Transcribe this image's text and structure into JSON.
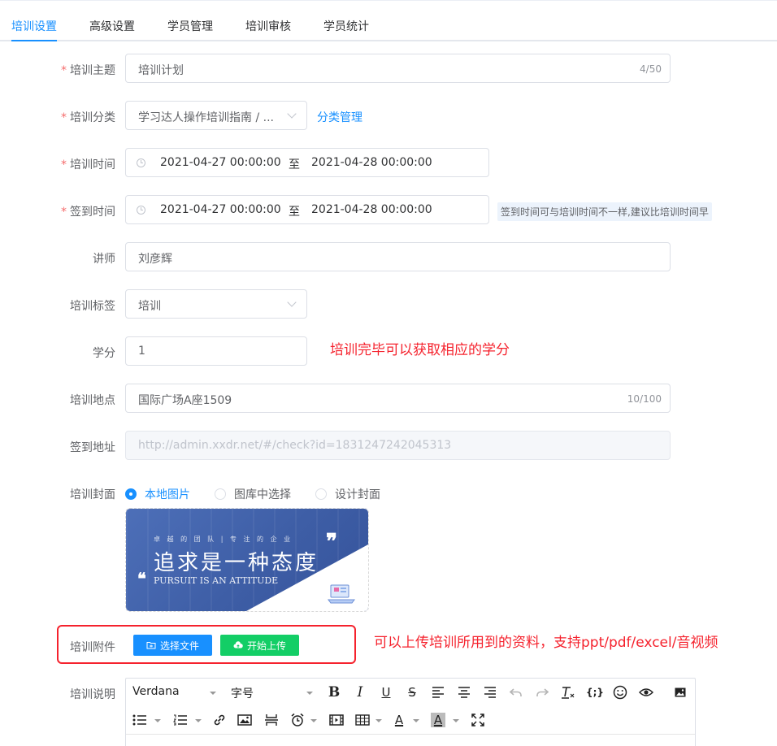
{
  "tabs": [
    {
      "label": "培训设置",
      "active": true
    },
    {
      "label": "高级设置",
      "active": false
    },
    {
      "label": "学员管理",
      "active": false
    },
    {
      "label": "培训审核",
      "active": false
    },
    {
      "label": "学员统计",
      "active": false
    }
  ],
  "form": {
    "topic": {
      "label": "培训主题",
      "value": "培训计划",
      "count": "4/50"
    },
    "category": {
      "label": "培训分类",
      "value": "学习达人操作培训指南 / ...",
      "manage_link": "分类管理"
    },
    "train_time": {
      "label": "培训时间",
      "start": "2021-04-27 00:00:00",
      "sep": "至",
      "end": "2021-04-28 00:00:00"
    },
    "signin_time": {
      "label": "签到时间",
      "start": "2021-04-27 00:00:00",
      "sep": "至",
      "end": "2021-04-28 00:00:00",
      "tip": "签到时间可与培训时间不一样,建议比培训时间早"
    },
    "lecturer": {
      "label": "讲师",
      "value": "刘彦辉"
    },
    "tag": {
      "label": "培训标签",
      "value": "培训"
    },
    "credit": {
      "label": "学分",
      "value": "1",
      "annotation": "培训完毕可以获取相应的学分"
    },
    "location": {
      "label": "培训地点",
      "value": "国际广场A座1509",
      "count": "10/100"
    },
    "signin_url": {
      "label": "签到地址",
      "value": "http://admin.xxdr.net/#/check?id=1831247242045313"
    },
    "cover": {
      "label": "培训封面",
      "options": [
        {
          "label": "本地图片",
          "checked": true
        },
        {
          "label": "图库中选择",
          "checked": false
        },
        {
          "label": "设计封面",
          "checked": false
        }
      ],
      "image": {
        "subtitle": "卓 越 的 团 队 | 专 注 的 企 业",
        "title": "追求是一种态度",
        "english": "PURSUIT IS AN ATTITUDE"
      }
    },
    "attachment": {
      "label": "培训附件",
      "choose_button": "选择文件",
      "upload_button": "开始上传",
      "annotation": "可以上传培训所用到的资料，支持ppt/pdf/excel/音视频"
    },
    "description": {
      "label": "培训说明",
      "font_family": "Verdana",
      "font_size": "字号",
      "font_color_glyph": "A",
      "bg_color_glyph": "A",
      "code_glyph": "{;}"
    }
  },
  "colors": {
    "primary": "#1890ff",
    "success": "#13ce66",
    "required": "#f56c6c",
    "annotation": "#f5222d"
  }
}
